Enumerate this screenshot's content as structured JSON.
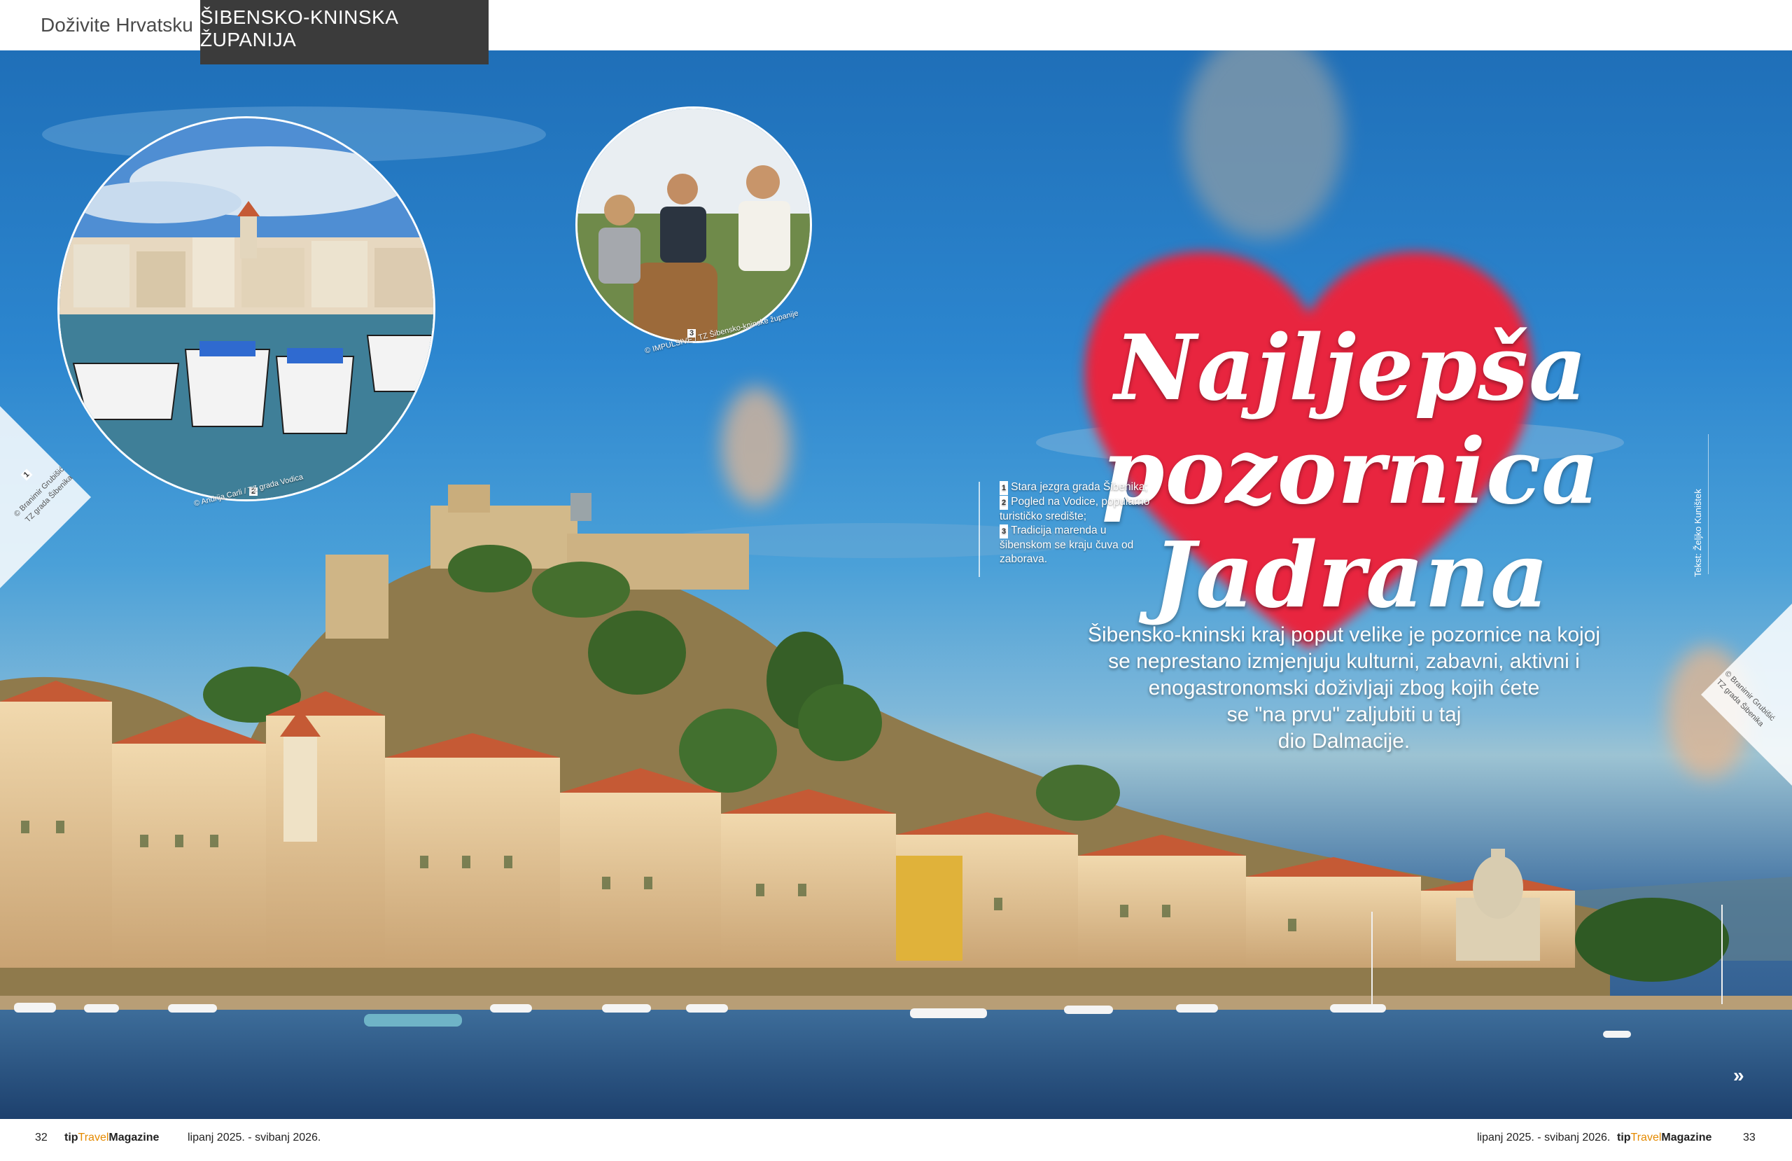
{
  "header": {
    "section": "Doživite Hrvatsku",
    "tab": "ŠIBENSKO-KNINSKA ŽUPANIJA"
  },
  "article": {
    "title_line1": "Najljepša pozornica",
    "title_line2": "Jadrana",
    "lead_lines": [
      "Šibensko-kninski kraj poput velike je pozornice na kojoj",
      "se neprestano izmjenjuju kulturni, zabavni, aktivni i",
      "enogastronomski doživljaji zbog kojih ćete",
      "se \"na prvu\" zaljubiti u taj",
      "dio Dalmacije."
    ],
    "captions": [
      {
        "num": "1",
        "text": "Stara jezgra grada Šibenika;"
      },
      {
        "num": "2",
        "text": "Pogled na Vodice, popularno turističko središte;"
      },
      {
        "num": "3",
        "text": "Tradicija marenda u šibenskom se kraju čuva od zaborava."
      }
    ],
    "author": "Tekst: Željko Kuništek",
    "continue_mark": "»"
  },
  "photos": {
    "circle2_num": "2",
    "circle2_credit": "© Andrija Carli / TZ grada Vodica",
    "circle3_num": "3",
    "circle3_credit": "© IMPULSIVE / TZ Šibensko-kninske županije",
    "corner_left_num": "1",
    "corner_left_credit_1": "© Branimir Grubišić",
    "corner_left_credit_2": "TZ grada Šibenika",
    "corner_right_credit_1": "© Branimir Grubišić",
    "corner_right_credit_2": "TZ grada Šibenika"
  },
  "footer": {
    "left_page": "32",
    "mag_tip": "tip",
    "mag_travel": "Travel",
    "mag_magazine": "Magazine",
    "left_date": "lipanj 2025. - svibanj 2026.",
    "right_date": "lipanj 2025. - svibanj 2026.",
    "right_page": "33"
  },
  "colors": {
    "tab_bg": "#3b3b3b",
    "heart": "#e8253f",
    "sky": "#2c86cf",
    "sea": "#264e80",
    "roof": "#c8603a",
    "stone": "#e6c89a"
  }
}
